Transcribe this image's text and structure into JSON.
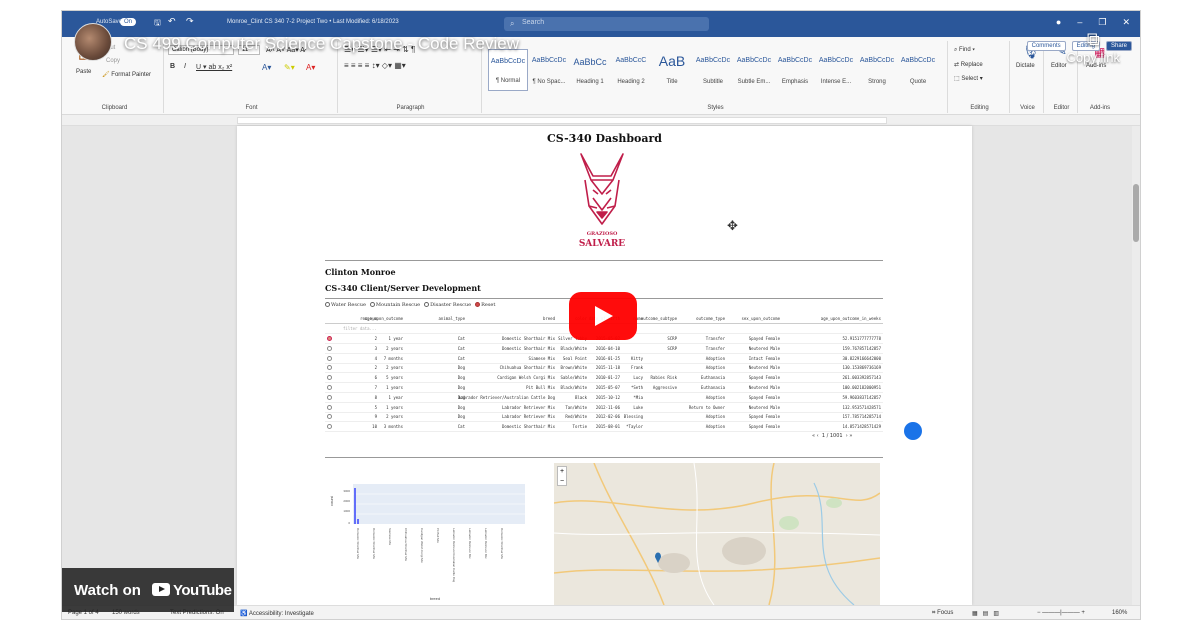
{
  "video": {
    "title": "CS 499 Computer Science Capstone - Code Review",
    "copy_link": "Copy link",
    "watch_on": "Watch on",
    "youtube": "YouTube"
  },
  "word": {
    "autosave": "AutoSave",
    "autosave_state": "On",
    "doc_title": "Monroe_Clint CS 340 7-2 Project Two • Last Modified: 6/18/2023",
    "search_placeholder": "Search",
    "comments": "Comments",
    "editing": "Editing",
    "share": "Share"
  },
  "ribbon": {
    "clipboard": {
      "paste": "Paste",
      "cut": "Cut",
      "copy": "Copy",
      "format_painter": "Format Painter",
      "label": "Clipboard"
    },
    "font": {
      "name": "Calibri (Body)",
      "size": "11",
      "label": "Font"
    },
    "paragraph": {
      "label": "Paragraph"
    },
    "styles": {
      "label": "Styles",
      "tiles": [
        {
          "preview": "AaBbCcDc",
          "name": "¶ Normal"
        },
        {
          "preview": "AaBbCcDc",
          "name": "¶ No Spac..."
        },
        {
          "preview": "AaBbCc",
          "name": "Heading 1"
        },
        {
          "preview": "AaBbCcC",
          "name": "Heading 2"
        },
        {
          "preview": "AaB",
          "name": "Title"
        },
        {
          "preview": "AaBbCcDc",
          "name": "Subtitle"
        },
        {
          "preview": "AaBbCcDc",
          "name": "Subtle Em..."
        },
        {
          "preview": "AaBbCcDc",
          "name": "Emphasis"
        },
        {
          "preview": "AaBbCcDc",
          "name": "Intense E..."
        },
        {
          "preview": "AaBbCcDc",
          "name": "Strong"
        },
        {
          "preview": "AaBbCcDc",
          "name": "Quote"
        }
      ]
    },
    "editing": {
      "find": "Find",
      "replace": "Replace",
      "select": "Select",
      "label": "Editing"
    },
    "voice": {
      "dictate": "Dictate",
      "label": "Voice"
    },
    "editor": {
      "editor": "Editor",
      "label": "Editor"
    },
    "addins": {
      "addins": "Add-ins",
      "label": "Add-ins"
    }
  },
  "document": {
    "dashboard_title": "CS-340 Dashboard",
    "logo_line1": "GRAZIOSO",
    "logo_line2": "SALVARE",
    "author": "Clinton Monroe",
    "subtitle": "CS-340 Client/Server Development",
    "filters": [
      "Water Rescue",
      "Mountain Rescue",
      "Disaster Rescue",
      "Reset"
    ],
    "selected_filter": 3,
    "table": {
      "headers": [
        "rec_num",
        "age_upon_outcome",
        "animal_type",
        "breed",
        "color",
        "date_of_birth",
        "name",
        "outcome_subtype",
        "outcome_type",
        "sex_upon_outcome",
        "age_upon_outcome_in_weeks"
      ],
      "filter_placeholder": "filter data...",
      "rows": [
        [
          "2",
          "1 year",
          "Cat",
          "Domestic Shorthair Mix",
          "Silver Tabby",
          "2015-05-02",
          "",
          "SCRP",
          "Transfer",
          "Spayed Female",
          "52.9151777777778"
        ],
        [
          "3",
          "2 years",
          "Cat",
          "Domestic Shorthair Mix",
          "Black/White",
          "2016-04-10",
          "",
          "SCRP",
          "Transfer",
          "Neutered Male",
          "159.767857142857"
        ],
        [
          "4",
          "7 months",
          "Cat",
          "Siamese Mix",
          "Seal Point",
          "2016-01-25",
          "Kitty",
          "",
          "Adoption",
          "Intact Female",
          "30.8229166642000"
        ],
        [
          "2",
          "2 years",
          "Dog",
          "Chihuahua Shorthair Mix",
          "Brown/White",
          "2015-11-18",
          "Frank",
          "",
          "Adoption",
          "Neutered Male",
          "130.153869736169"
        ],
        [
          "6",
          "5 years",
          "Dog",
          "Cardigan Welsh Corgi Mix",
          "Sable/White",
          "2010-01-27",
          "Lucy",
          "Rabies Risk",
          "Euthanasia",
          "Spayed Female",
          "261.003392857143"
        ],
        [
          "7",
          "1 years",
          "Dog",
          "Pit Bull Mix",
          "Black/White",
          "2015-05-07",
          "*Seth",
          "Aggressive",
          "Euthanasia",
          "Neutered Male",
          "100.002182000951"
        ],
        [
          "8",
          "1 year",
          "Dog",
          "Labrador Retriever/Australian Cattle Dog",
          "Black",
          "2015-10-12",
          "*Mia",
          "",
          "Adoption",
          "Spayed Female",
          "59.9603837142857"
        ],
        [
          "5",
          "1 years",
          "Dog",
          "Labrador Retriever Mix",
          "Tan/White",
          "2012-11-06",
          "Luke",
          "",
          "Return to Owner",
          "Neutered Male",
          "132.953571428571"
        ],
        [
          "9",
          "2 years",
          "Dog",
          "Labrador Retriever Mix",
          "Red/White",
          "2012-02-06",
          "Blessing",
          "",
          "Adoption",
          "Spayed Female",
          "157.785714285714"
        ],
        [
          "10",
          "3 months",
          "Cat",
          "Domestic Shorthair Mix",
          "Tortie",
          "2015-08-01",
          "*Taylor",
          "",
          "Adoption",
          "Spayed Female",
          "14.8571428571429"
        ]
      ],
      "pager": "1 / 1001"
    },
    "chart_ylabel": "count",
    "chart_xlabel": "breed",
    "chart_ticks": [
      "3000",
      "2000",
      "1000",
      "0"
    ]
  },
  "status": {
    "page": "Page 1 of 4",
    "words": "150 words",
    "predictions": "Text Predictions: On",
    "accessibility": "Accessibility: Investigate",
    "focus": "Focus",
    "zoom": "160%"
  }
}
